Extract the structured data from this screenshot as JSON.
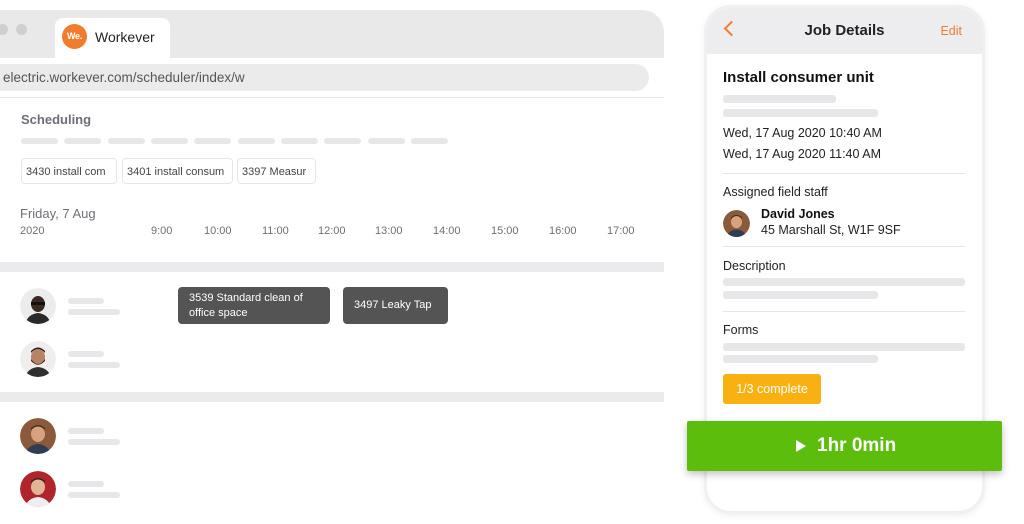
{
  "browser": {
    "tab_title": "Workever",
    "logo_text": "We.",
    "url": "electric.workever.com/scheduler/index/w"
  },
  "scheduler": {
    "title": "Scheduling",
    "job_chips": [
      "3430 install com",
      "3401 install consum",
      "3397 Measur"
    ],
    "date": "Friday, 7 Aug",
    "year": "2020",
    "hours": [
      "9:00",
      "10:00",
      "11:00",
      "12:00",
      "13:00",
      "14:00",
      "15:00",
      "16:00",
      "17:00"
    ],
    "events": [
      {
        "label": "3539 Standard clean of office space"
      },
      {
        "label": "3497 Leaky Tap"
      }
    ]
  },
  "job_details": {
    "header_title": "Job Details",
    "edit_label": "Edit",
    "job_title": "Install consumer unit",
    "start": "Wed, 17 Aug 2020 10:40 AM",
    "end": "Wed, 17 Aug 2020 11:40 AM",
    "assigned_label": "Assigned field staff",
    "staff_name": "David Jones",
    "staff_address": "45 Marshall St, W1F 9SF",
    "description_label": "Description",
    "forms_label": "Forms",
    "forms_status": "1/3 complete"
  },
  "timer": {
    "label": "1hr 0min"
  },
  "icons": {
    "back": "chevron-left-icon",
    "play": "play-icon"
  },
  "colors": {
    "accent_orange": "#f07c2e",
    "timer_green": "#5dbd0c",
    "forms_badge_yellow": "#f8b110",
    "event_gray": "#545454"
  }
}
